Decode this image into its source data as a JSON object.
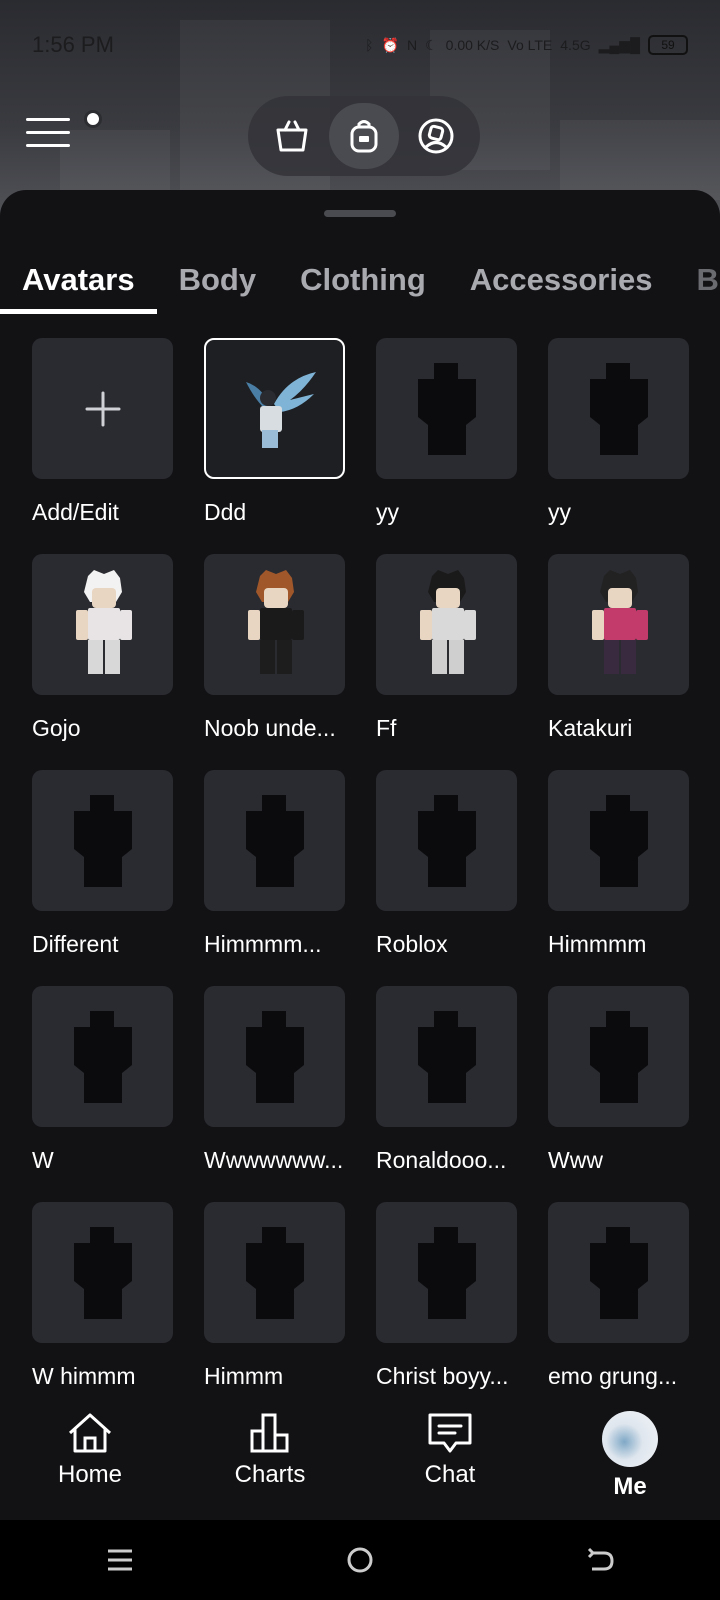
{
  "status": {
    "time": "1:56 PM",
    "net_speed": "0.00 K/S",
    "network": "4.5G",
    "carrier": "Vo LTE",
    "battery": "59"
  },
  "topbar": {
    "segments": [
      {
        "icon": "shopping-bag-icon",
        "active": false
      },
      {
        "icon": "backpack-icon",
        "active": true
      },
      {
        "icon": "avatar-circle-icon",
        "active": false
      }
    ]
  },
  "tabs": [
    {
      "label": "Avatars",
      "active": true
    },
    {
      "label": "Body",
      "active": false
    },
    {
      "label": "Clothing",
      "active": false
    },
    {
      "label": "Accessories",
      "active": false
    },
    {
      "label": "B",
      "active": false
    }
  ],
  "avatars": [
    {
      "label": "Add/Edit",
      "type": "add"
    },
    {
      "label": "Ddd",
      "type": "winged",
      "selected": true
    },
    {
      "label": "yy",
      "type": "silhouette"
    },
    {
      "label": "yy",
      "type": "silhouette"
    },
    {
      "label": "Gojo",
      "type": "character",
      "colors": {
        "hair": "#f2f2f2",
        "torso": "#e8e4e6",
        "legs": "#d8d8d8"
      }
    },
    {
      "label": "Noob unde...",
      "type": "character",
      "colors": {
        "hair": "#a0582a",
        "torso": "#1a1a1a",
        "legs": "#1d1d1d"
      }
    },
    {
      "label": "Ff",
      "type": "character",
      "colors": {
        "hair": "#1a1a1a",
        "torso": "#d9d9d9",
        "legs": "#cfcfcf"
      }
    },
    {
      "label": "Katakuri",
      "type": "character",
      "colors": {
        "hair": "#222222",
        "torso": "#c23b6a",
        "legs": "#3a2a40"
      }
    },
    {
      "label": "Different",
      "type": "silhouette"
    },
    {
      "label": "Himmmm...",
      "type": "silhouette"
    },
    {
      "label": "Roblox",
      "type": "silhouette"
    },
    {
      "label": "Himmmm",
      "type": "silhouette"
    },
    {
      "label": "W",
      "type": "silhouette"
    },
    {
      "label": "Wwwwwww...",
      "type": "silhouette"
    },
    {
      "label": "Ronaldooo...",
      "type": "silhouette"
    },
    {
      "label": "Www",
      "type": "silhouette"
    },
    {
      "label": "W himmm",
      "type": "silhouette"
    },
    {
      "label": "Himmm",
      "type": "silhouette"
    },
    {
      "label": "Christ boyy...",
      "type": "silhouette"
    },
    {
      "label": "emo grung...",
      "type": "silhouette"
    }
  ],
  "bottom_nav": [
    {
      "label": "Home",
      "icon": "home-icon"
    },
    {
      "label": "Charts",
      "icon": "charts-icon"
    },
    {
      "label": "Chat",
      "icon": "chat-icon"
    },
    {
      "label": "Me",
      "icon": "profile-avatar"
    }
  ]
}
